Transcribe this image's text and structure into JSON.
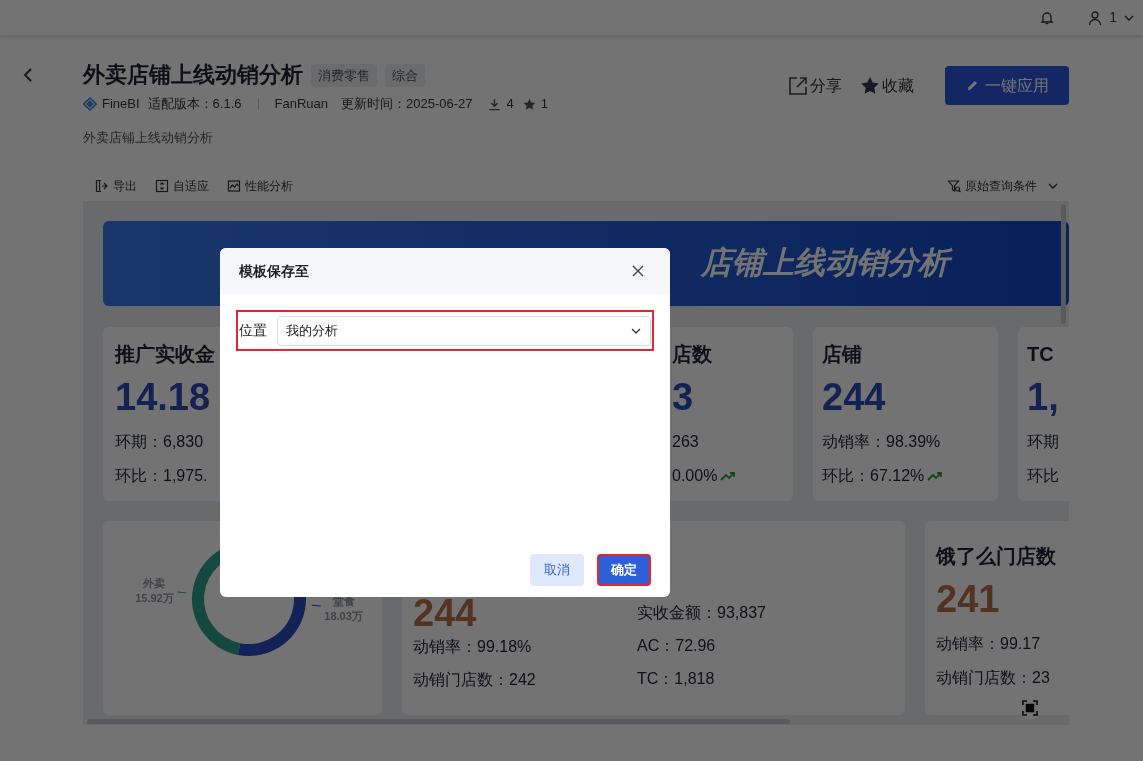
{
  "top_bar": {
    "user": "1"
  },
  "header": {
    "title": "外卖店铺上线动销分析",
    "tags": [
      "消费零售",
      "综合"
    ],
    "product": "FineBI",
    "version": "适配版本：6.1.6",
    "author": "FanRuan",
    "updated": "更新时间：2025-06-27",
    "downloads": "4",
    "favorites": "1",
    "description": "外卖店铺上线动销分析",
    "actions": [
      {
        "kind": "share",
        "label": "分享"
      },
      {
        "kind": "favorite",
        "label": "收藏"
      }
    ],
    "apply_button": "一键应用"
  },
  "toolbar": {
    "items": [
      {
        "kind": "export",
        "label": "导出"
      },
      {
        "kind": "fit",
        "label": "自适应"
      },
      {
        "kind": "performance",
        "label": "性能分析"
      }
    ],
    "filter": "原始查询条件"
  },
  "dashboard": {
    "banner": "店铺上线动销分析",
    "kpi_cards": [
      {
        "title": "推广实收金",
        "value": "14.18",
        "lines": [
          {
            "text": "环期：6,830",
            "rising": false
          },
          {
            "text": "环比：1,975.",
            "rising": false
          }
        ]
      },
      {
        "title": "店数",
        "value": "3",
        "lines": [
          {
            "text": "263",
            "rising": false
          },
          {
            "text": "0.00%",
            "rising": true
          }
        ]
      },
      {
        "title": "店铺",
        "value": "244",
        "lines": [
          {
            "text": "动销率：98.39%",
            "rising": false
          },
          {
            "text": "环比：67.12%",
            "rising": true
          }
        ]
      },
      {
        "title": "TC",
        "value": "1,",
        "lines": [
          {
            "text": "环期",
            "rising": false
          },
          {
            "text": "环比",
            "rising": false
          }
        ]
      }
    ],
    "donut_card": {
      "chart_data": {
        "type": "donut",
        "categories": [
          "堂食",
          "外卖"
        ],
        "values": [
          18.03,
          15.92
        ],
        "value_labels": [
          "18.03万",
          "15.92万"
        ]
      }
    },
    "summary_card": {
      "value": "244",
      "left_lines": [
        "动销率：99.18%",
        "动销门店数：242"
      ],
      "right_lines": [
        "实收金额：93,837",
        "AC：72.96",
        "TC：1,818"
      ]
    },
    "eleme_card": {
      "title": "饿了么门店数",
      "value": "241",
      "lines": [
        "动销率：99.17",
        "动销门店数：23"
      ]
    }
  },
  "modal": {
    "title": "模板保存至",
    "field": {
      "label": "位置",
      "value": "我的分析",
      "highlighted": true
    },
    "buttons": [
      {
        "kind": "secondary",
        "label": "取消",
        "highlighted": false
      },
      {
        "kind": "primary",
        "label": "确定",
        "highlighted": true
      }
    ]
  }
}
